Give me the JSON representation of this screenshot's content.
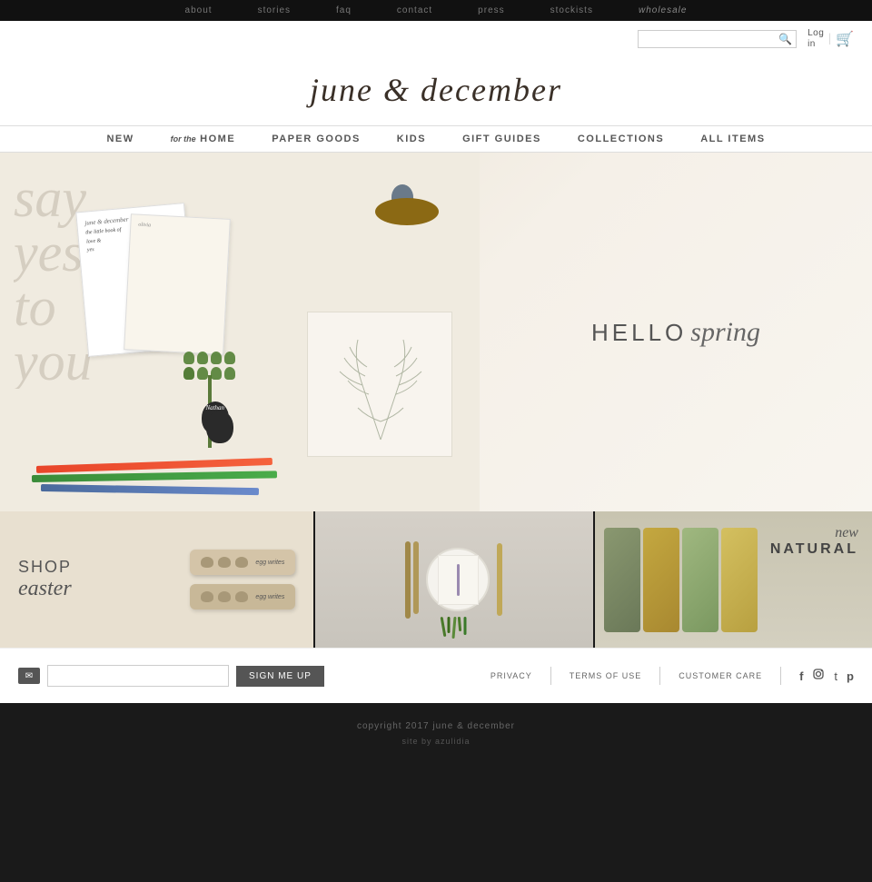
{
  "topNav": {
    "items": [
      {
        "label": "about",
        "href": "#"
      },
      {
        "label": "stories",
        "href": "#"
      },
      {
        "label": "FAQ",
        "href": "#"
      },
      {
        "label": "contact",
        "href": "#"
      },
      {
        "label": "press",
        "href": "#"
      },
      {
        "label": "stockists",
        "href": "#"
      }
    ],
    "wholesale": "wholesale"
  },
  "header": {
    "siteName": "june & december",
    "search": {
      "placeholder": "",
      "button": "🔍"
    },
    "login": {
      "line1": "Log",
      "line2": "in"
    },
    "cart": "🛒"
  },
  "mainNav": {
    "items": [
      {
        "label": "NEW",
        "key": "new"
      },
      {
        "label": "for the HOME",
        "key": "home",
        "italic_prefix": "for the"
      },
      {
        "label": "PAPER GOODS",
        "key": "paper"
      },
      {
        "label": "KIDS",
        "key": "kids"
      },
      {
        "label": "GIFT GUIDES",
        "key": "gift"
      },
      {
        "label": "COLLECTIONS",
        "key": "collections"
      },
      {
        "label": "ALL ITEMS",
        "key": "all"
      }
    ]
  },
  "hero": {
    "helloText": "HELLO",
    "springText": "spring"
  },
  "promos": {
    "easter": {
      "shop": "SHOP",
      "easter": "easter",
      "eggLabel1": "egg writes",
      "eggLabel2": "egg writes"
    },
    "natural": {
      "new": "new",
      "natural": "NATURAL"
    }
  },
  "footer": {
    "newsletter": {
      "inputPlaceholder": "",
      "buttonLabel": "SIGN ME UP"
    },
    "links": [
      {
        "label": "PRIVACY"
      },
      {
        "label": "TERMS OF USE"
      },
      {
        "label": "CUSTOMER CARE"
      }
    ],
    "social": {
      "facebook": "f",
      "instagram": "📷",
      "twitter": "t",
      "pinterest": "p"
    },
    "copyright": "copyright 2017 june & december",
    "siteBy": "site by azulidia"
  }
}
